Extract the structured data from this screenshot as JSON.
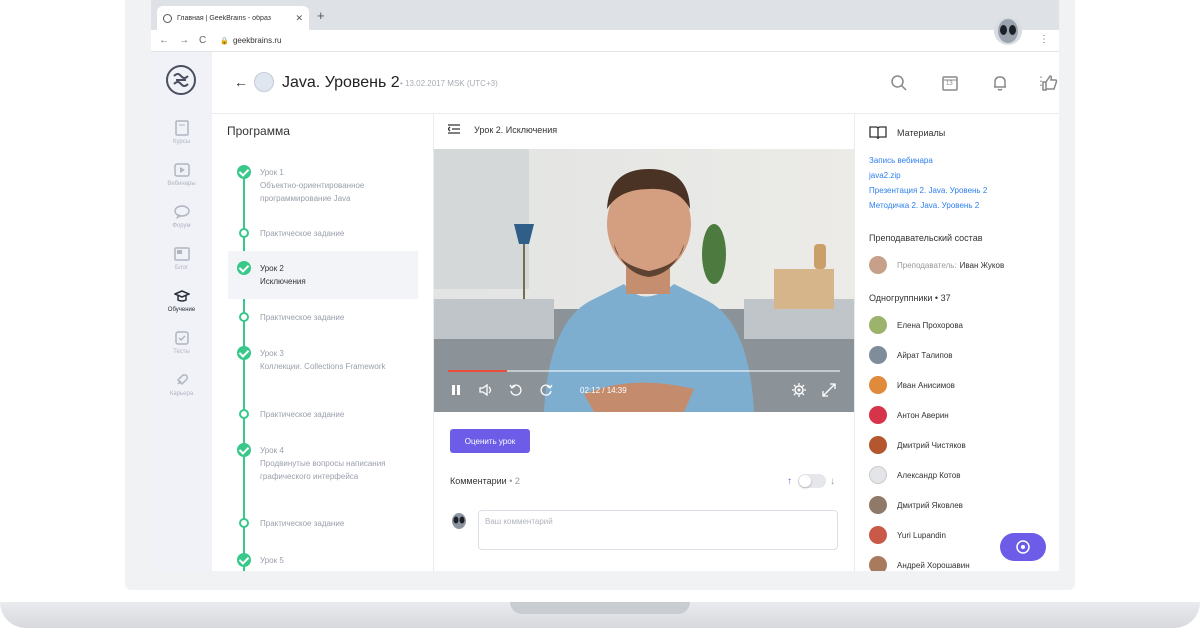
{
  "browser": {
    "tab_title": "Главная | GeekBrains - образ",
    "tab_close": "✕",
    "new_tab": "+",
    "back": "←",
    "forward": "→",
    "reload": "C",
    "url": "geekbrains.ru",
    "menu": "⋮"
  },
  "sidebar": {
    "items": [
      {
        "label": "Курсы",
        "icon": "book-icon"
      },
      {
        "label": "Вебинары",
        "icon": "play-icon"
      },
      {
        "label": "Форум",
        "icon": "chat-icon"
      },
      {
        "label": "Блог",
        "icon": "blog-icon"
      },
      {
        "label": "Обучение",
        "icon": "graduation-cap-icon",
        "active": true
      },
      {
        "label": "Тесты",
        "icon": "checkbox-icon"
      },
      {
        "label": "Карьера",
        "icon": "rocket-icon"
      }
    ]
  },
  "header": {
    "back": "←",
    "title": "Java. Уровень 2",
    "date": "• 13.02.2017 MSK (UTC+3)",
    "calendar_day": "13",
    "menu": "⋮"
  },
  "program": {
    "title": "Программа",
    "lessons": [
      {
        "title": "Урок 1",
        "subtitle": "Объектно-ориентированное программирование Java"
      },
      {
        "title": "Практическое задание"
      },
      {
        "title": "Урок 2",
        "subtitle": "Исключения",
        "active": true
      },
      {
        "title": "Практическое задание"
      },
      {
        "title": "Урок 3",
        "subtitle": "Коллекции. Collections Framework"
      },
      {
        "title": "Практическое задание"
      },
      {
        "title": "Урок 4",
        "subtitle": "Продвинутые вопросы написания графического интерфейса"
      },
      {
        "title": "Практическое задание"
      },
      {
        "title": "Урок 5"
      }
    ]
  },
  "lesson": {
    "title": "Урок 2. Исключения",
    "video_time": "02:12 / 14:39",
    "progress": 0.15,
    "rate_button": "Оценить урок",
    "comments_label": "Комментарии",
    "comments_count": "• 2",
    "comment_placeholder": "Ваш комментарий"
  },
  "materials": {
    "title": "Материалы",
    "links": [
      "Запись вебинара",
      "java2.zip",
      "Презентация 2. Java. Уровень 2",
      "Методичка 2. Java. Уровень 2"
    ]
  },
  "staff": {
    "title": "Преподавательский состав",
    "role": "Преподаватель:",
    "name": "Иван Жуков"
  },
  "classmates": {
    "title": "Одногруппники • 37",
    "people": [
      "Елена Прохорова",
      "Айрат Талипов",
      "Иван Анисимов",
      "Антон Аверин",
      "Дмитрий Чистяков",
      "Александр Котов",
      "Дмитрий Яковлев",
      "Yuri Lupandin",
      "Андрей Хорошавин"
    ]
  },
  "colors": {
    "accent": "#6c5ce7",
    "success": "#37c88a",
    "link": "#2f80ed",
    "progress": "#e74c3c"
  }
}
